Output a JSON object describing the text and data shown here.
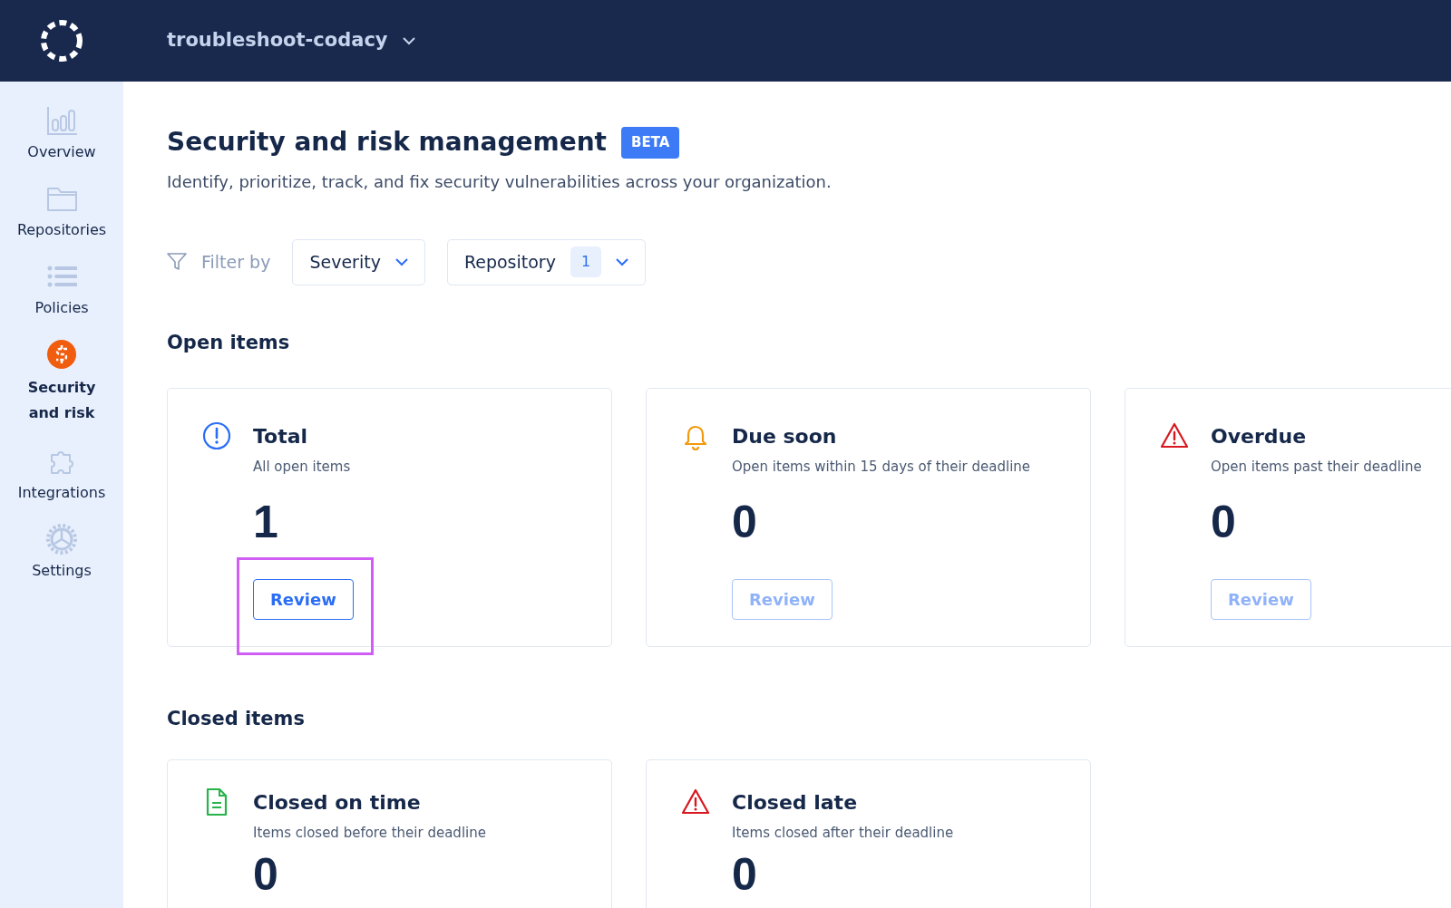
{
  "topbar": {
    "organization": "troubleshoot-codacy"
  },
  "sidebar": {
    "items": [
      {
        "label": "Overview",
        "selected": false
      },
      {
        "label": "Repositories",
        "selected": false
      },
      {
        "label": "Policies",
        "selected": false
      },
      {
        "label": "Security and risk",
        "selected": true
      },
      {
        "label": "Integrations",
        "selected": false
      },
      {
        "label": "Settings",
        "selected": false
      }
    ]
  },
  "header": {
    "title": "Security and risk management",
    "badge": "BETA",
    "subtitle": "Identify, prioritize, track, and fix security vulnerabilities across your organization."
  },
  "filters": {
    "label": "Filter by",
    "dropdowns": [
      {
        "label": "Severity"
      },
      {
        "label": "Repository",
        "count": "1"
      }
    ]
  },
  "sections": [
    {
      "title": "Open items",
      "cards": [
        {
          "title": "Total",
          "description": "All open items",
          "value": "1",
          "button": "Review",
          "disabled": false,
          "highlighted": true
        },
        {
          "title": "Due soon",
          "description": "Open items within 15 days of their deadline",
          "value": "0",
          "button": "Review",
          "disabled": true,
          "highlighted": false
        },
        {
          "title": "Overdue",
          "description": "Open items past their deadline",
          "value": "0",
          "button": "Review",
          "disabled": true,
          "highlighted": false
        }
      ]
    },
    {
      "title": "Closed items",
      "cards": [
        {
          "title": "Closed on time",
          "description": "Items closed before their deadline",
          "value": "0"
        },
        {
          "title": "Closed late",
          "description": "Items closed after their deadline",
          "value": "0"
        }
      ]
    }
  ]
}
